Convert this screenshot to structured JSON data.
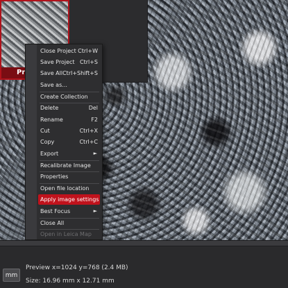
{
  "thumbnail": {
    "label": "Pr"
  },
  "menu": {
    "items": [
      {
        "label": "Close Project",
        "shortcut": "Ctrl+W"
      },
      {
        "label": "Save Project",
        "shortcut": "Ctrl+S"
      },
      {
        "label": "Save All",
        "shortcut": "Ctrl+Shift+S"
      },
      {
        "label": "Save as...",
        "shortcut": ""
      },
      {
        "label": "Create Collection",
        "shortcut": ""
      },
      {
        "label": "Delete",
        "shortcut": "Del"
      },
      {
        "label": "Rename",
        "shortcut": "F2"
      },
      {
        "label": "Cut",
        "shortcut": "Ctrl+X"
      },
      {
        "label": "Copy",
        "shortcut": "Ctrl+C"
      },
      {
        "label": "Export",
        "shortcut": "►"
      },
      {
        "label": "Recalibrate Image",
        "shortcut": ""
      },
      {
        "label": "Properties",
        "shortcut": ""
      },
      {
        "label": "Open file location",
        "shortcut": ""
      },
      {
        "label": "Apply image settings",
        "shortcut": ""
      },
      {
        "label": "Best Focus",
        "shortcut": "►"
      },
      {
        "label": "Close All",
        "shortcut": ""
      },
      {
        "label": "Open in Leica Map",
        "shortcut": ""
      }
    ]
  },
  "statusbar": {
    "unit_button": "mm",
    "preview": "Preview x=1024 y=768  (2.4 MB)",
    "size": "Size: 16.96 mm x 12.71 mm"
  },
  "colors": {
    "accent": "#c0121c",
    "menu_bg": "#2e2e30"
  }
}
